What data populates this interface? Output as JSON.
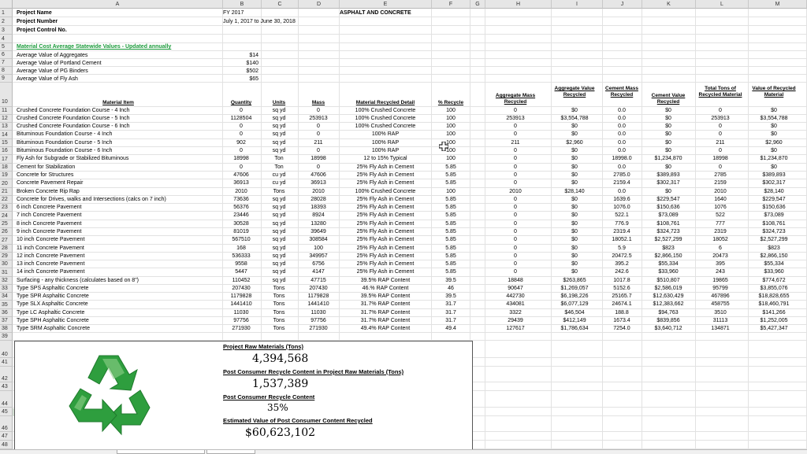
{
  "columns": [
    "A",
    "B",
    "C",
    "D",
    "E",
    "F",
    "G",
    "H",
    "I",
    "J",
    "K",
    "L",
    "M"
  ],
  "rows": [
    "1",
    "2",
    "3",
    "4",
    "5",
    "6",
    "7",
    "8",
    "9",
    "10",
    "11",
    "12",
    "13",
    "14",
    "15",
    "16",
    "17",
    "18",
    "19",
    "20",
    "21",
    "22",
    "23",
    "24",
    "25",
    "26",
    "27",
    "28",
    "29",
    "30",
    "31",
    "32",
    "33",
    "34",
    "35",
    "36",
    "37",
    "38",
    "39",
    "40",
    "41",
    "42",
    "43",
    "44",
    "45",
    "46",
    "47",
    "48"
  ],
  "top": {
    "project_name_label": "Project Name",
    "project_number_label": "Project Number",
    "project_control_label": "Project Control No.",
    "fy": "FY 2017",
    "dates": "July 1, 2017 to June 30, 2018",
    "title": "ASPHALT AND CONCRETE",
    "section_title": "Material Cost Average Statewide Values - Updated annually",
    "avg_aggregates_label": "Average Value of Aggregates",
    "avg_aggregates": "$14",
    "avg_cement_label": "Average Value of Portland Cement",
    "avg_cement": "$140",
    "avg_binders_label": "Average Value of PG Binders",
    "avg_binders": "$502",
    "avg_flyash_label": "Average Value of Fly Ash",
    "avg_flyash": "$65"
  },
  "headers": {
    "material_item": "Material Item",
    "quantity": "Quantity",
    "units": "Units",
    "mass": "Mass",
    "recycled_detail": "Material Recycled Detail",
    "pct_recycle": "% Recycle",
    "agg_mass": "Aggregate Mass Recycled",
    "agg_value": "Aggregate Value Recycled",
    "cement_mass": "Cement Mass Recycled",
    "cement_value": "Cement Value Recycled",
    "total_tons": "Total Tons of Recycled Material",
    "value_recycled": "Value of Recycled Material"
  },
  "table_rows": [
    {
      "item": "Crushed Concrete Foundation Course - 4 Inch",
      "qty": "0",
      "units": "sq yd",
      "mass": "0",
      "detail": "100% Crushed Concrete",
      "pct": "100",
      "agg_mass": "0",
      "agg_value": "$0",
      "cem_mass": "0.0",
      "cem_value": "$0",
      "total": "0",
      "value": "$0"
    },
    {
      "item": "Crushed Concrete Foundation Course - 5 Inch",
      "qty": "1128504",
      "units": "sq yd",
      "mass": "253913",
      "detail": "100% Crushed Concrete",
      "pct": "100",
      "agg_mass": "253913",
      "agg_value": "$3,554,788",
      "cem_mass": "0.0",
      "cem_value": "$0",
      "total": "253913",
      "value": "$3,554,788"
    },
    {
      "item": "Crushed Concrete Foundation Course - 6 Inch",
      "qty": "0",
      "units": "sq yd",
      "mass": "0",
      "detail": "100% Crushed Concrete",
      "pct": "100",
      "agg_mass": "0",
      "agg_value": "$0",
      "cem_mass": "0.0",
      "cem_value": "$0",
      "total": "0",
      "value": "$0"
    },
    {
      "item": "Bituminous Foundation Course - 4 Inch",
      "qty": "0",
      "units": "sq yd",
      "mass": "0",
      "detail": "100% RAP",
      "pct": "100",
      "agg_mass": "0",
      "agg_value": "$0",
      "cem_mass": "0.0",
      "cem_value": "$0",
      "total": "0",
      "value": "$0"
    },
    {
      "item": "Bituminous Foundation Course - 5 Inch",
      "qty": "902",
      "units": "sq yd",
      "mass": "211",
      "detail": "100% RAP",
      "pct": "100",
      "agg_mass": "211",
      "agg_value": "$2,960",
      "cem_mass": "0.0",
      "cem_value": "$0",
      "total": "211",
      "value": "$2,960"
    },
    {
      "item": "Bituminous Foundation Course - 6 Inch",
      "qty": "0",
      "units": "sq yd",
      "mass": "0",
      "detail": "100% RAP",
      "pct": "100",
      "agg_mass": "0",
      "agg_value": "$0",
      "cem_mass": "0.0",
      "cem_value": "$0",
      "total": "0",
      "value": "$0"
    },
    {
      "item": "Fly Ash for Subgrade or Stabilized Bituminous",
      "qty": "18998",
      "units": "Ton",
      "mass": "18998",
      "detail": "12 to 15% Typical",
      "pct": "100",
      "agg_mass": "0",
      "agg_value": "$0",
      "cem_mass": "18998.0",
      "cem_value": "$1,234,870",
      "total": "18998",
      "value": "$1,234,870"
    },
    {
      "item": "Cement for Stabilization",
      "qty": "0",
      "units": "Ton",
      "mass": "0",
      "detail": "25% Fly Ash in Cement",
      "pct": "5.85",
      "agg_mass": "0",
      "agg_value": "$0",
      "cem_mass": "0.0",
      "cem_value": "$0",
      "total": "0",
      "value": "$0"
    },
    {
      "item": "Concrete for Structures",
      "qty": "47606",
      "units": "cu yd",
      "mass": "47606",
      "detail": "25% Fly Ash in Cement",
      "pct": "5.85",
      "agg_mass": "0",
      "agg_value": "$0",
      "cem_mass": "2785.0",
      "cem_value": "$389,893",
      "total": "2785",
      "value": "$389,893"
    },
    {
      "item": "Concrete Pavement Repair",
      "qty": "36913",
      "units": "cu yd",
      "mass": "36913",
      "detail": "25% Fly Ash in Cement",
      "pct": "5.85",
      "agg_mass": "0",
      "agg_value": "$0",
      "cem_mass": "2159.4",
      "cem_value": "$302,317",
      "total": "2159",
      "value": "$302,317"
    },
    {
      "item": "Broken Concrete Rip Rap",
      "qty": "2010",
      "units": "Tons",
      "mass": "2010",
      "detail": "100% Crushed Concrete",
      "pct": "100",
      "agg_mass": "2010",
      "agg_value": "$28,140",
      "cem_mass": "0.0",
      "cem_value": "$0",
      "total": "2010",
      "value": "$28,140"
    },
    {
      "item": "Concrete for Drives, walks and Intersections (calcs on 7 inch)",
      "qty": "73636",
      "units": "sq yd",
      "mass": "28028",
      "detail": "25% Fly Ash in Cement",
      "pct": "5.85",
      "agg_mass": "0",
      "agg_value": "$0",
      "cem_mass": "1639.6",
      "cem_value": "$229,547",
      "total": "1640",
      "value": "$229,547"
    },
    {
      "item": "6 inch Concrete Pavement",
      "qty": "56376",
      "units": "sq yd",
      "mass": "18393",
      "detail": "25% Fly Ash in Cement",
      "pct": "5.85",
      "agg_mass": "0",
      "agg_value": "$0",
      "cem_mass": "1076.0",
      "cem_value": "$150,636",
      "total": "1076",
      "value": "$150,636"
    },
    {
      "item": "7 inch Concrete Pavement",
      "qty": "23446",
      "units": "sq yd",
      "mass": "8924",
      "detail": "25% Fly Ash in Cement",
      "pct": "5.85",
      "agg_mass": "0",
      "agg_value": "$0",
      "cem_mass": "522.1",
      "cem_value": "$73,089",
      "total": "522",
      "value": "$73,089"
    },
    {
      "item": "8 inch Concrete Pavement",
      "qty": "30528",
      "units": "sq yd",
      "mass": "13280",
      "detail": "25% Fly Ash in Cement",
      "pct": "5.85",
      "agg_mass": "0",
      "agg_value": "$0",
      "cem_mass": "776.9",
      "cem_value": "$108,761",
      "total": "777",
      "value": "$108,761"
    },
    {
      "item": "9 inch Concrete Pavement",
      "qty": "81019",
      "units": "sq yd",
      "mass": "39649",
      "detail": "25% Fly Ash in Cement",
      "pct": "5.85",
      "agg_mass": "0",
      "agg_value": "$0",
      "cem_mass": "2319.4",
      "cem_value": "$324,723",
      "total": "2319",
      "value": "$324,723"
    },
    {
      "item": "10 inch Concrete Pavement",
      "qty": "567510",
      "units": "sq yd",
      "mass": "308584",
      "detail": "25% Fly Ash in Cement",
      "pct": "5.85",
      "agg_mass": "0",
      "agg_value": "$0",
      "cem_mass": "18052.1",
      "cem_value": "$2,527,299",
      "total": "18052",
      "value": "$2,527,299"
    },
    {
      "item": "11 inch Concrete Pavement",
      "qty": "168",
      "units": "sq yd",
      "mass": "100",
      "detail": "25% Fly Ash in Cement",
      "pct": "5.85",
      "agg_mass": "0",
      "agg_value": "$0",
      "cem_mass": "5.9",
      "cem_value": "$823",
      "total": "6",
      "value": "$823"
    },
    {
      "item": "12 inch Concrete Pavement",
      "qty": "536333",
      "units": "sq yd",
      "mass": "349957",
      "detail": "25% Fly Ash in Cement",
      "pct": "5.85",
      "agg_mass": "0",
      "agg_value": "$0",
      "cem_mass": "20472.5",
      "cem_value": "$2,866,150",
      "total": "20473",
      "value": "$2,866,150"
    },
    {
      "item": "13 inch Concrete Pavement",
      "qty": "9558",
      "units": "sq yd",
      "mass": "6756",
      "detail": "25% Fly Ash in Cement",
      "pct": "5.85",
      "agg_mass": "0",
      "agg_value": "$0",
      "cem_mass": "395.2",
      "cem_value": "$55,334",
      "total": "395",
      "value": "$55,334"
    },
    {
      "item": "14 inch Concrete Pavement",
      "qty": "5447",
      "units": "sq yd",
      "mass": "4147",
      "detail": "25% Fly Ash in Cement",
      "pct": "5.85",
      "agg_mass": "0",
      "agg_value": "$0",
      "cem_mass": "242.6",
      "cem_value": "$33,960",
      "total": "243",
      "value": "$33,960"
    },
    {
      "item": "Surfacing - any thickness (calculates based on 8\")",
      "qty": "110452",
      "units": "sq yd",
      "mass": "47715",
      "detail": "39.5% RAP Content",
      "pct": "39.5",
      "agg_mass": "18848",
      "agg_value": "$263,865",
      "cem_mass": "1017.8",
      "cem_value": "$510,807",
      "total": "19865",
      "value": "$774,672"
    },
    {
      "item": "Type SPS Asphaltic Concrete",
      "qty": "207430",
      "units": "Tons",
      "mass": "207430",
      "detail": "46.% RAP Content",
      "pct": "46",
      "agg_mass": "90647",
      "agg_value": "$1,269,057",
      "cem_mass": "5152.6",
      "cem_value": "$2,586,019",
      "total": "95799",
      "value": "$3,855,076"
    },
    {
      "item": "Type SPR Asphaltic Concrete",
      "qty": "1179828",
      "units": "Tons",
      "mass": "1179828",
      "detail": "39.5% RAP Content",
      "pct": "39.5",
      "agg_mass": "442730",
      "agg_value": "$6,198,226",
      "cem_mass": "25165.7",
      "cem_value": "$12,630,429",
      "total": "467896",
      "value": "$18,828,655"
    },
    {
      "item": "Type SLX Asphaltic Concrete",
      "qty": "1441410",
      "units": "Tons",
      "mass": "1441410",
      "detail": "31.7% RAP Content",
      "pct": "31.7",
      "agg_mass": "434081",
      "agg_value": "$6,077,129",
      "cem_mass": "24674.1",
      "cem_value": "$12,383,662",
      "total": "458755",
      "value": "$18,460,791"
    },
    {
      "item": "Type LC Asphaltic Concrete",
      "qty": "11030",
      "units": "Tons",
      "mass": "11030",
      "detail": "31.7% RAP Content",
      "pct": "31.7",
      "agg_mass": "3322",
      "agg_value": "$46,504",
      "cem_mass": "188.8",
      "cem_value": "$94,763",
      "total": "3510",
      "value": "$141,266"
    },
    {
      "item": "Type SPH Asphaltic Concrete",
      "qty": "97756",
      "units": "Tons",
      "mass": "97756",
      "detail": "31.7% RAP Content",
      "pct": "31.7",
      "agg_mass": "29439",
      "agg_value": "$412,149",
      "cem_mass": "1673.4",
      "cem_value": "$839,856",
      "total": "31113",
      "value": "$1,252,005"
    },
    {
      "item": "Type SRM Asphaltic Concrete",
      "qty": "271930",
      "units": "Tons",
      "mass": "271930",
      "detail": "49.4% RAP Content",
      "pct": "49.4",
      "agg_mass": "127617",
      "agg_value": "$1,786,634",
      "cem_mass": "7254.0",
      "cem_value": "$3,640,712",
      "total": "134871",
      "value": "$5,427,347"
    }
  ],
  "summary": {
    "raw_label": "Project Raw Materials (Tons)",
    "raw_value": "4,394,568",
    "post_label": "Post Consumer Recycle Content in Project Raw Materials (Tons)",
    "post_value": "1,537,389",
    "pct_label": "Post Consumer Recycle Content",
    "pct_value": "35%",
    "est_label": "Estimated Value of Post Consumer Content Recycled",
    "est_value": "$60,623,102"
  },
  "colors": {
    "recycle_green": "#2e9e3e",
    "section_green": "#1a9a3a"
  },
  "icons": {
    "logo": "recycle-icon"
  }
}
